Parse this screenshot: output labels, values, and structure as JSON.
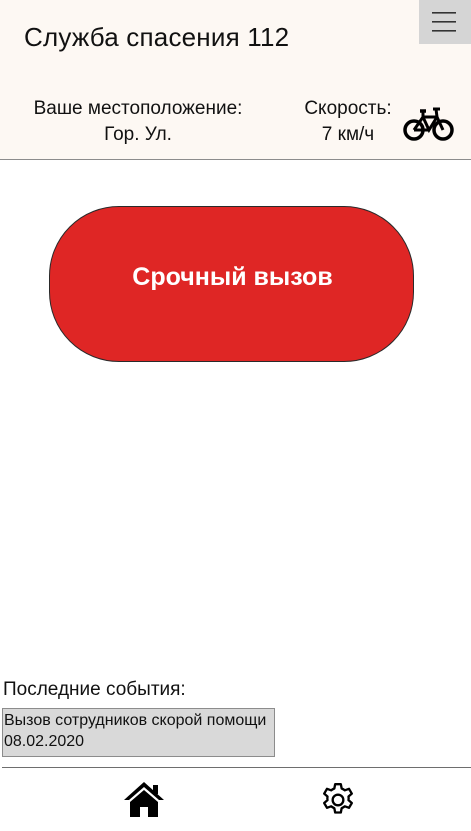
{
  "header": {
    "title": "Служба спасения 112",
    "menu_icon": "hamburger-menu-icon"
  },
  "location": {
    "label": "Ваше местоположение:",
    "value": "Гор. Ул."
  },
  "speed": {
    "label": "Скорость:",
    "value": "7 км/ч",
    "icon": "bicycle-icon"
  },
  "emergency": {
    "button_label": "Срочный вызов",
    "color": "#df2625"
  },
  "events": {
    "title": "Последние события:",
    "items": [
      "Вызов сотрудников скорой помощи 08.02.2020"
    ]
  },
  "bottom_nav": {
    "home_icon": "home-icon",
    "settings_icon": "gear-icon"
  }
}
